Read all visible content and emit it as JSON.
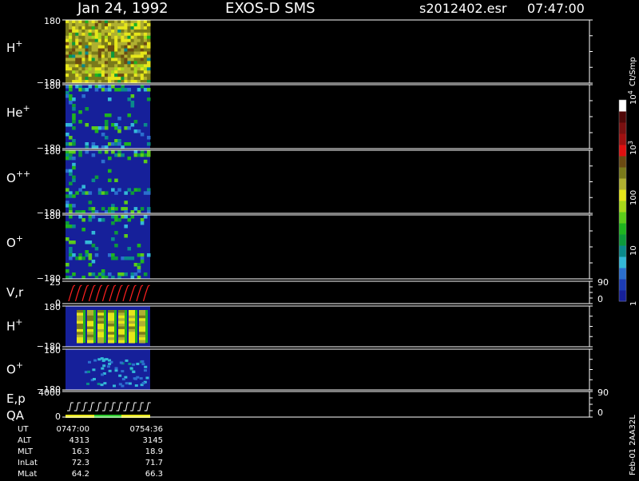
{
  "header": {
    "date": "Jan 24, 1992",
    "instrument": "EXOS-D SMS",
    "file_id": "s2012402.esr",
    "time": "07:47:00"
  },
  "panels": [
    {
      "label": "H",
      "sup": "+",
      "y_top": "180",
      "y_bot": "−180"
    },
    {
      "label": "He",
      "sup": "+",
      "y_top": "180",
      "y_bot": "−180"
    },
    {
      "label": "O",
      "sup": "++",
      "y_top": "180",
      "y_bot": "−180"
    },
    {
      "label": "O",
      "sup": "+",
      "y_top": "180",
      "y_bot": "−180"
    },
    {
      "label": "V,r",
      "sup": "",
      "y_top": "25",
      "y_bot": "0",
      "r_top": "90",
      "r_bot": "0"
    },
    {
      "label": "H",
      "sup": "+",
      "y_top": "180",
      "y_bot": "−180"
    },
    {
      "label": "O",
      "sup": "+",
      "y_top": "180",
      "y_bot": "−180"
    },
    {
      "label": "E,p",
      "sup": "",
      "label2": "QA",
      "y_top": "4000",
      "y_bot": "0",
      "r_top": "90",
      "r_bot": "0"
    }
  ],
  "colorbar": {
    "unit": "Ct/Smp",
    "ticks": [
      {
        "value": 1,
        "text": "1"
      },
      {
        "value": 10,
        "text": "10"
      },
      {
        "value": 100,
        "text": "100"
      },
      {
        "value": 1000,
        "text": "10",
        "sup": "3"
      },
      {
        "value": 10000,
        "text": "10",
        "sup": "4"
      }
    ],
    "colors": [
      "#16209a",
      "#1c3cb4",
      "#2b6fcf",
      "#33b8d8",
      "#0a8a8a",
      "#0d9a3a",
      "#1fb41f",
      "#5ccc1a",
      "#a8d81a",
      "#e6e61a",
      "#b0b030",
      "#7a7a1a",
      "#6b4a12",
      "#e01010",
      "#a01010",
      "#7a1010",
      "#500808",
      "#ffffff"
    ]
  },
  "side_note": "Feb-01  2AA32L",
  "footer": {
    "rows": [
      {
        "key": "UT",
        "v1": "0747:00",
        "v2": "0754:36"
      },
      {
        "key": "ALT",
        "v1": "4313",
        "v2": "3145"
      },
      {
        "key": "MLT",
        "v1": "16.3",
        "v2": "18.9"
      },
      {
        "key": "InLat",
        "v1": "72.3",
        "v2": "71.7"
      },
      {
        "key": "MLat",
        "v1": "64.2",
        "v2": "66.3"
      }
    ]
  },
  "colors": {
    "background": "#000000",
    "frame": "#ffffff",
    "velocity_trace": "#ff2020",
    "qa_yellow": "#e8e81a",
    "qa_green": "#2ecc2e"
  },
  "chart_data": {
    "type": "heatmap",
    "time_range": [
      "0747:00",
      "0754:36"
    ],
    "y_range_pitch": [
      -180,
      180
    ],
    "log_scale_colorbar": true,
    "colorbar_range": [
      1,
      10000
    ],
    "panels_with_data": 8
  }
}
